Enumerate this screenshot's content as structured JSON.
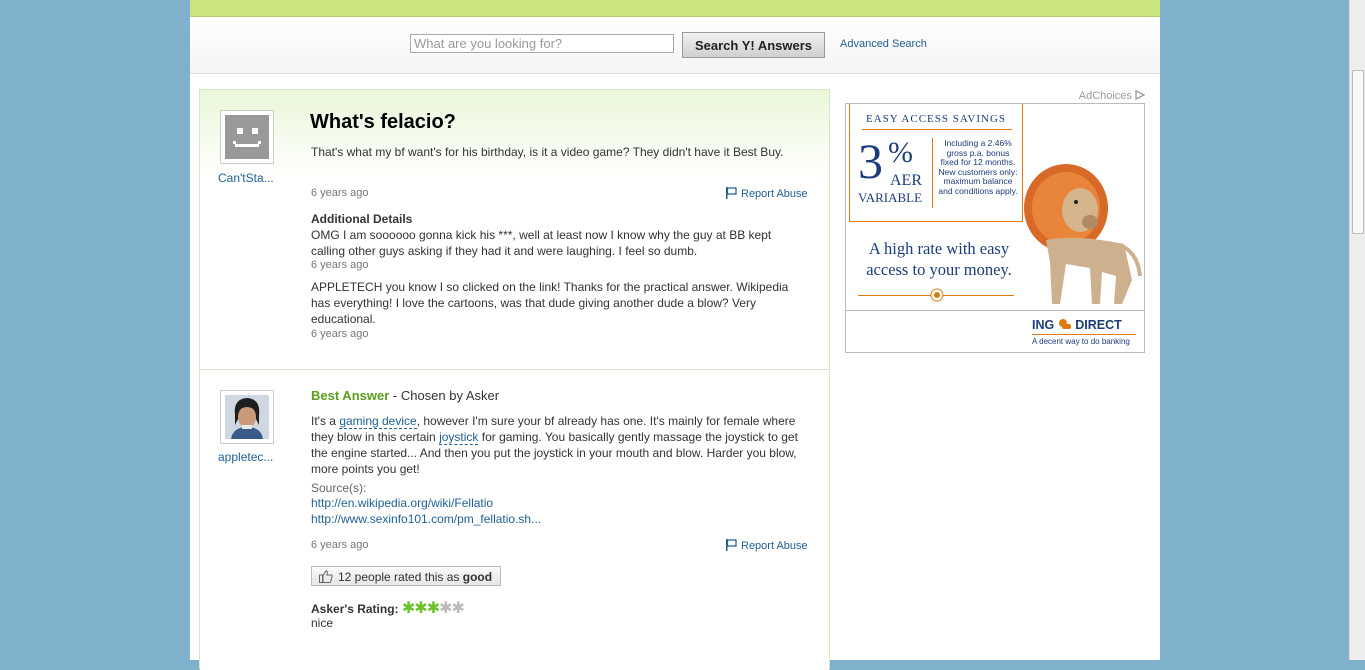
{
  "search": {
    "placeholder": "What are you looking for?",
    "button_label": "Search Y! Answers",
    "advanced_label": "Advanced Search"
  },
  "question": {
    "user_name": "Can'tSta...",
    "title": "What's felacio?",
    "body": "That's what my bf want's for his birthday, is it a video game? They didn't have it Best Buy.",
    "time": "6 years ago",
    "report_label": "Report Abuse",
    "details_heading": "Additional Details",
    "detail_1_text": "OMG I am soooooo gonna kick his ***, well at least now I know why the guy at BB kept calling other guys asking if they had it and were laughing. I feel so dumb.",
    "detail_1_time": "6 years ago",
    "detail_2_text": "APPLETECH you know I so clicked on the link! Thanks for the practical answer. Wikipedia has everything! I love the cartoons, was that dude giving another dude a blow? Very educational.",
    "detail_2_time": "6 years ago"
  },
  "answer": {
    "user_name": "appletec...",
    "best_label": "Best Answer",
    "chosen_label": " - Chosen by Asker",
    "text_1": "It's a ",
    "link_1": "gaming device",
    "text_2": ", however I'm sure your bf already has one. It's mainly for female where they blow in this certain ",
    "link_2": "joystick",
    "text_3": " for gaming. You basically gently massage the joystick to get the engine started... And then you put the joystick in your mouth and blow. Harder you blow, more points you get!",
    "sources_label": "Source(s):",
    "source_1": "http://en.wikipedia.org/wiki/Fellatio",
    "source_2": "http://www.sexinfo101.com/pm_fellatio.sh...",
    "time": "6 years ago",
    "report_label": "Report Abuse",
    "rated_prefix": "12 people rated this as ",
    "rated_word": "good",
    "asker_rating_label": "Asker's Rating:",
    "asker_rating_value": 3,
    "asker_rating_max": 5,
    "asker_comment": "nice"
  },
  "ad": {
    "adchoices_label": "AdChoices",
    "heading": "EASY ACCESS SAVINGS",
    "rate": "3",
    "percent": "%",
    "aer": "AER",
    "variable": "VARIABLE",
    "fine_print": "Including a 2.46% gross p.a. bonus fixed for 12 months. New customers only: maximum balance and conditions apply.",
    "tagline": "A high rate with easy access to your money.",
    "brand": "ING",
    "brand_2": "DIRECT",
    "slogan": "A decent way to do banking"
  },
  "colors": {
    "topbar": "#cbe680",
    "link": "#1f5f93",
    "best_answer_green": "#5a9e1b",
    "ad_orange": "#e07b12",
    "ad_navy": "#1d3c7a"
  }
}
